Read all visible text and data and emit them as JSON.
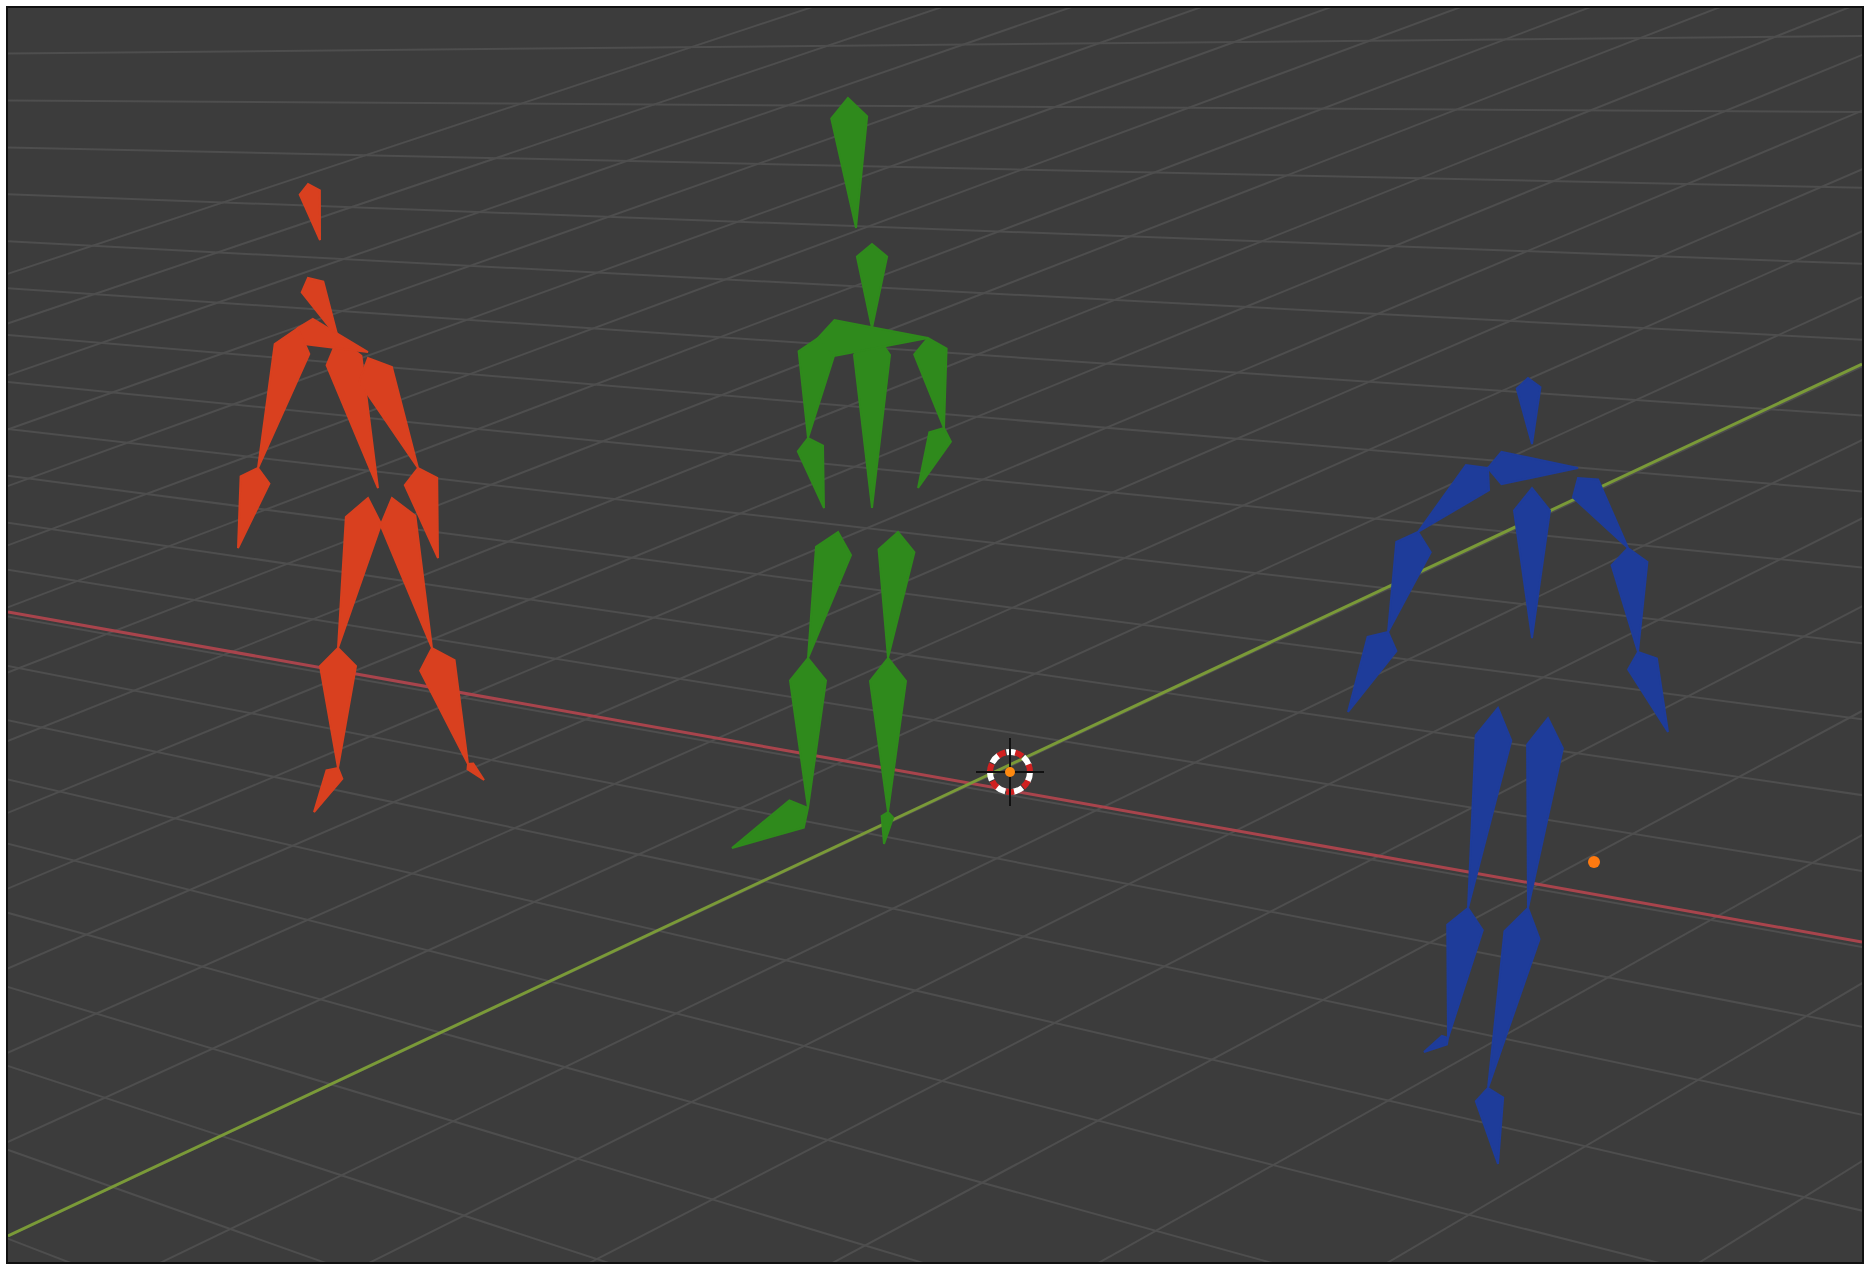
{
  "viewport": {
    "armatures": [
      {
        "color": "#d9401f"
      },
      {
        "color": "#2f8a1c"
      },
      {
        "color": "#1e3c9a"
      }
    ]
  }
}
